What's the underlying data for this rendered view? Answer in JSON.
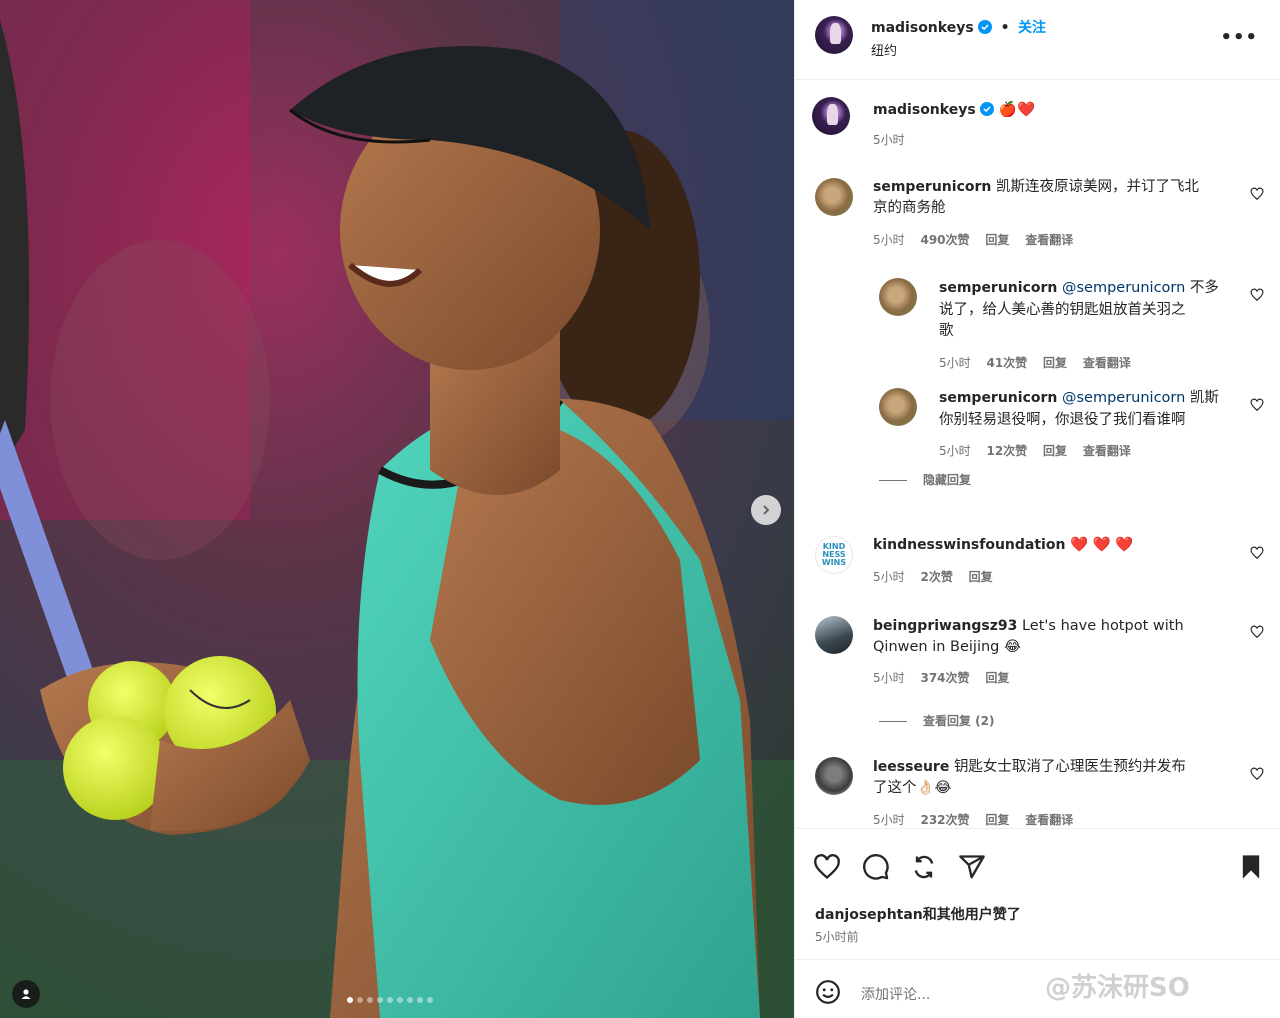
{
  "post": {
    "username": "madisonkeys",
    "follow_label": "关注",
    "location": "纽约",
    "more_label": "•••",
    "caption_emojis": "🍎❤️",
    "caption_time": "5小时",
    "photo_dots": 9,
    "photo_active_dot": 0
  },
  "comments": [
    {
      "user": "semperunicorn",
      "text_line1": "凯斯连夜原谅美网，并订了飞北",
      "text_line2": "京的商务舱",
      "time": "5小时",
      "likes": "490次赞",
      "reply": "回复",
      "translate": "查看翻译"
    },
    {
      "user": "semperunicorn",
      "mention": "@semperunicorn",
      "text_line1_tail": "不多",
      "text_line2": "说了，给人美心善的钥匙姐放首关羽之",
      "text_line3": "歌",
      "time": "5小时",
      "likes": "41次赞",
      "reply": "回复",
      "translate": "查看翻译"
    },
    {
      "user": "semperunicorn",
      "mention": "@semperunicorn",
      "text_line1_tail": "凯斯",
      "text_line2": "你别轻易退役啊，你退役了我们看谁啊",
      "time": "5小时",
      "likes": "12次赞",
      "reply": "回复",
      "translate": "查看翻译"
    },
    {
      "hide_replies": "隐藏回复"
    },
    {
      "user": "kindnesswinsfoundation",
      "text_line1": "❤️ ❤️ ❤️",
      "avatar_text": [
        "KIND",
        "NESS",
        "WINS"
      ],
      "time": "5小时",
      "likes": "2次赞",
      "reply": "回复"
    },
    {
      "user": "beingpriwangsz93",
      "text_line1": "Let's have hotpot with",
      "text_line2": "Qinwen in Beijing 😂",
      "time": "5小时",
      "likes": "374次赞",
      "reply": "回复",
      "view_replies": "查看回复 (2)"
    },
    {
      "user": "leesseure",
      "text_line1": "钥匙女士取消了心理医生预约并发布",
      "text_line2": "了这个👌🏻😂",
      "time": "5小时",
      "likes": "232次赞",
      "reply": "回复",
      "translate": "查看翻译"
    }
  ],
  "footer": {
    "liked_by_user": "danjosephtan",
    "liked_by_rest": "和其他用户赞了",
    "time_ago": "5小时前",
    "comment_placeholder": "添加评论...",
    "watermark": "@苏沫研SO"
  },
  "colors": {
    "link": "#0095f6",
    "mention": "#00376b",
    "muted": "#737373",
    "text": "#262626"
  },
  "icons": [
    "heart-icon",
    "comment-icon",
    "repost-icon",
    "share-icon",
    "bookmark-icon",
    "emoji-icon",
    "verified-icon",
    "next-arrow-icon",
    "person-tag-icon"
  ]
}
